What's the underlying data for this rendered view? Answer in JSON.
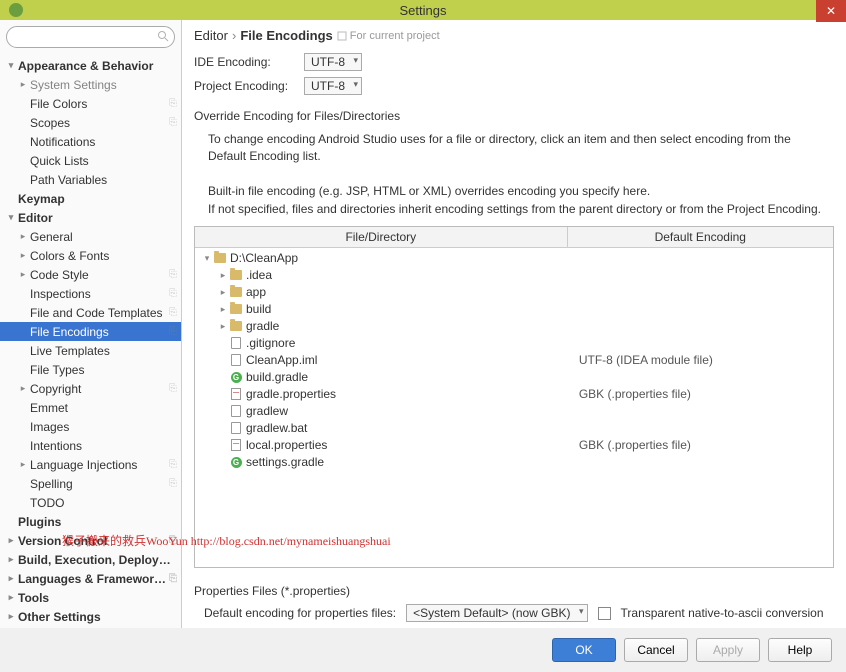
{
  "window": {
    "title": "Settings"
  },
  "search": {
    "placeholder": ""
  },
  "sidebar": {
    "items": [
      {
        "label": "Appearance & Behavior",
        "bold": true,
        "arrow": "▾",
        "indent": 0
      },
      {
        "label": "System Settings",
        "arrow": "▸",
        "indent": 1,
        "dim": true
      },
      {
        "label": "File Colors",
        "indent": 1,
        "ext": true
      },
      {
        "label": "Scopes",
        "indent": 1,
        "ext": true
      },
      {
        "label": "Notifications",
        "indent": 1
      },
      {
        "label": "Quick Lists",
        "indent": 1
      },
      {
        "label": "Path Variables",
        "indent": 1
      },
      {
        "label": "Keymap",
        "bold": true,
        "indent": 0
      },
      {
        "label": "Editor",
        "bold": true,
        "arrow": "▾",
        "indent": 0
      },
      {
        "label": "General",
        "arrow": "▸",
        "indent": 1
      },
      {
        "label": "Colors & Fonts",
        "arrow": "▸",
        "indent": 1
      },
      {
        "label": "Code Style",
        "arrow": "▸",
        "indent": 1,
        "ext": true
      },
      {
        "label": "Inspections",
        "indent": 1,
        "ext": true
      },
      {
        "label": "File and Code Templates",
        "indent": 1,
        "ext": true
      },
      {
        "label": "File Encodings",
        "indent": 1,
        "ext": true,
        "selected": true
      },
      {
        "label": "Live Templates",
        "indent": 1
      },
      {
        "label": "File Types",
        "indent": 1
      },
      {
        "label": "Copyright",
        "arrow": "▸",
        "indent": 1,
        "ext": true
      },
      {
        "label": "Emmet",
        "indent": 1
      },
      {
        "label": "Images",
        "indent": 1
      },
      {
        "label": "Intentions",
        "indent": 1
      },
      {
        "label": "Language Injections",
        "arrow": "▸",
        "indent": 1,
        "ext": true
      },
      {
        "label": "Spelling",
        "indent": 1,
        "ext": true
      },
      {
        "label": "TODO",
        "indent": 1
      },
      {
        "label": "Plugins",
        "bold": true,
        "indent": 0
      },
      {
        "label": "Version Control",
        "bold": true,
        "arrow": "▸",
        "indent": 0,
        "ext": true
      },
      {
        "label": "Build, Execution, Deployment",
        "bold": true,
        "arrow": "▸",
        "indent": 0
      },
      {
        "label": "Languages & Frameworks",
        "bold": true,
        "arrow": "▸",
        "indent": 0,
        "ext": true
      },
      {
        "label": "Tools",
        "bold": true,
        "arrow": "▸",
        "indent": 0
      },
      {
        "label": "Other Settings",
        "bold": true,
        "arrow": "▸",
        "indent": 0
      }
    ]
  },
  "crumb": {
    "root": "Editor",
    "leaf": "File Encodings",
    "hint": "For current project"
  },
  "encoding": {
    "ide_label": "IDE Encoding:",
    "ide_value": "UTF-8",
    "project_label": "Project Encoding:",
    "project_value": "UTF-8"
  },
  "override_title": "Override Encoding for Files/Directories",
  "help": {
    "p1": "To change encoding Android Studio uses for a file or directory, click an item and then select encoding from the Default Encoding list.",
    "p2": "Built-in file encoding (e.g. JSP, HTML or XML) overrides encoding you specify here.",
    "p3": "If not specified, files and directories inherit encoding settings from the parent directory or from the Project Encoding."
  },
  "table": {
    "col1": "File/Directory",
    "col2": "Default Encoding",
    "rows": [
      {
        "arrow": "▾",
        "icon": "folder",
        "name": "D:\\CleanApp",
        "indent": 0,
        "enc": ""
      },
      {
        "arrow": "▸",
        "icon": "folder",
        "name": ".idea",
        "indent": 1,
        "enc": ""
      },
      {
        "arrow": "▸",
        "icon": "folder",
        "name": "app",
        "indent": 1,
        "enc": ""
      },
      {
        "arrow": "▸",
        "icon": "folder",
        "name": "build",
        "indent": 1,
        "enc": ""
      },
      {
        "arrow": "▸",
        "icon": "folder",
        "name": "gradle",
        "indent": 1,
        "enc": ""
      },
      {
        "arrow": "",
        "icon": "file",
        "name": ".gitignore",
        "indent": 1,
        "enc": ""
      },
      {
        "arrow": "",
        "icon": "file",
        "name": "CleanApp.iml",
        "indent": 1,
        "enc": "UTF-8 (IDEA module file)"
      },
      {
        "arrow": "",
        "icon": "gradle",
        "name": "build.gradle",
        "indent": 1,
        "enc": ""
      },
      {
        "arrow": "",
        "icon": "prop",
        "name": "gradle.properties",
        "indent": 1,
        "enc": "GBK (.properties file)"
      },
      {
        "arrow": "",
        "icon": "file",
        "name": "gradlew",
        "indent": 1,
        "enc": ""
      },
      {
        "arrow": "",
        "icon": "file",
        "name": "gradlew.bat",
        "indent": 1,
        "enc": ""
      },
      {
        "arrow": "",
        "icon": "prop",
        "name": "local.properties",
        "indent": 1,
        "enc": "GBK (.properties file)"
      },
      {
        "arrow": "",
        "icon": "gradle",
        "name": "settings.gradle",
        "indent": 1,
        "enc": ""
      }
    ]
  },
  "props": {
    "title": "Properties Files (*.properties)",
    "label": "Default encoding for properties files:",
    "value": "<System Default> (now GBK)",
    "cb_label": "Transparent native-to-ascii conversion"
  },
  "buttons": {
    "ok": "OK",
    "cancel": "Cancel",
    "apply": "Apply",
    "help": "Help"
  },
  "watermark": "猴子搬来的救兵WooYun http://blog.csdn.net/mynameishuangshuai"
}
